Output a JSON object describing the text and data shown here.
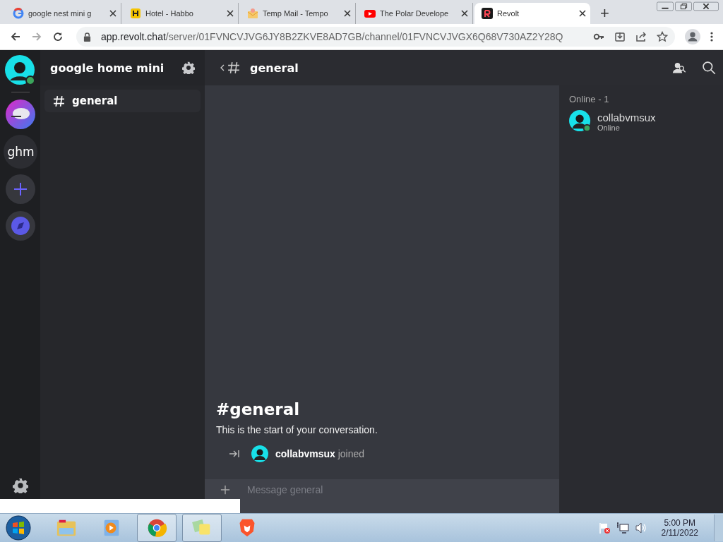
{
  "browser": {
    "tabs": [
      {
        "title": "google nest mini g",
        "selected": false
      },
      {
        "title": "Hotel - Habbo",
        "selected": false
      },
      {
        "title": "Temp Mail - Tempo",
        "selected": false
      },
      {
        "title": "The Polar Develope",
        "selected": false
      },
      {
        "title": "Revolt",
        "selected": true
      }
    ],
    "new_tab": "+",
    "address": {
      "host": "app.revolt.chat",
      "path": "/server/01FVNCVJVG6JY8B2ZKVE8AD7GB/channel/01FVNCVJVGX6Q68V730AZ2Y28Q"
    }
  },
  "servers": [
    {
      "kind": "avatar",
      "online": true
    },
    {
      "kind": "image"
    },
    {
      "kind": "text",
      "label": "ghm",
      "selected": true
    },
    {
      "kind": "add"
    },
    {
      "kind": "discover"
    }
  ],
  "server": {
    "name": "google home mini",
    "channels": [
      {
        "name": "general",
        "selected": true
      }
    ]
  },
  "channel_header": {
    "name": "general"
  },
  "welcome": {
    "title": "#general",
    "subtitle": "This is the start of your conversation."
  },
  "events": [
    {
      "user": "collabvmsux",
      "action": "joined"
    }
  ],
  "composer": {
    "placeholder": "Message general"
  },
  "members": {
    "heading": "Online - 1",
    "list": [
      {
        "name": "collabvmsux",
        "status": "Online",
        "online": true
      }
    ]
  },
  "taskbar": {
    "apps": [
      {
        "active": false
      },
      {
        "active": false
      },
      {
        "active": true
      },
      {
        "active": true
      },
      {
        "active": false
      }
    ],
    "time": "5:00 PM",
    "date": "2/11/2022"
  }
}
